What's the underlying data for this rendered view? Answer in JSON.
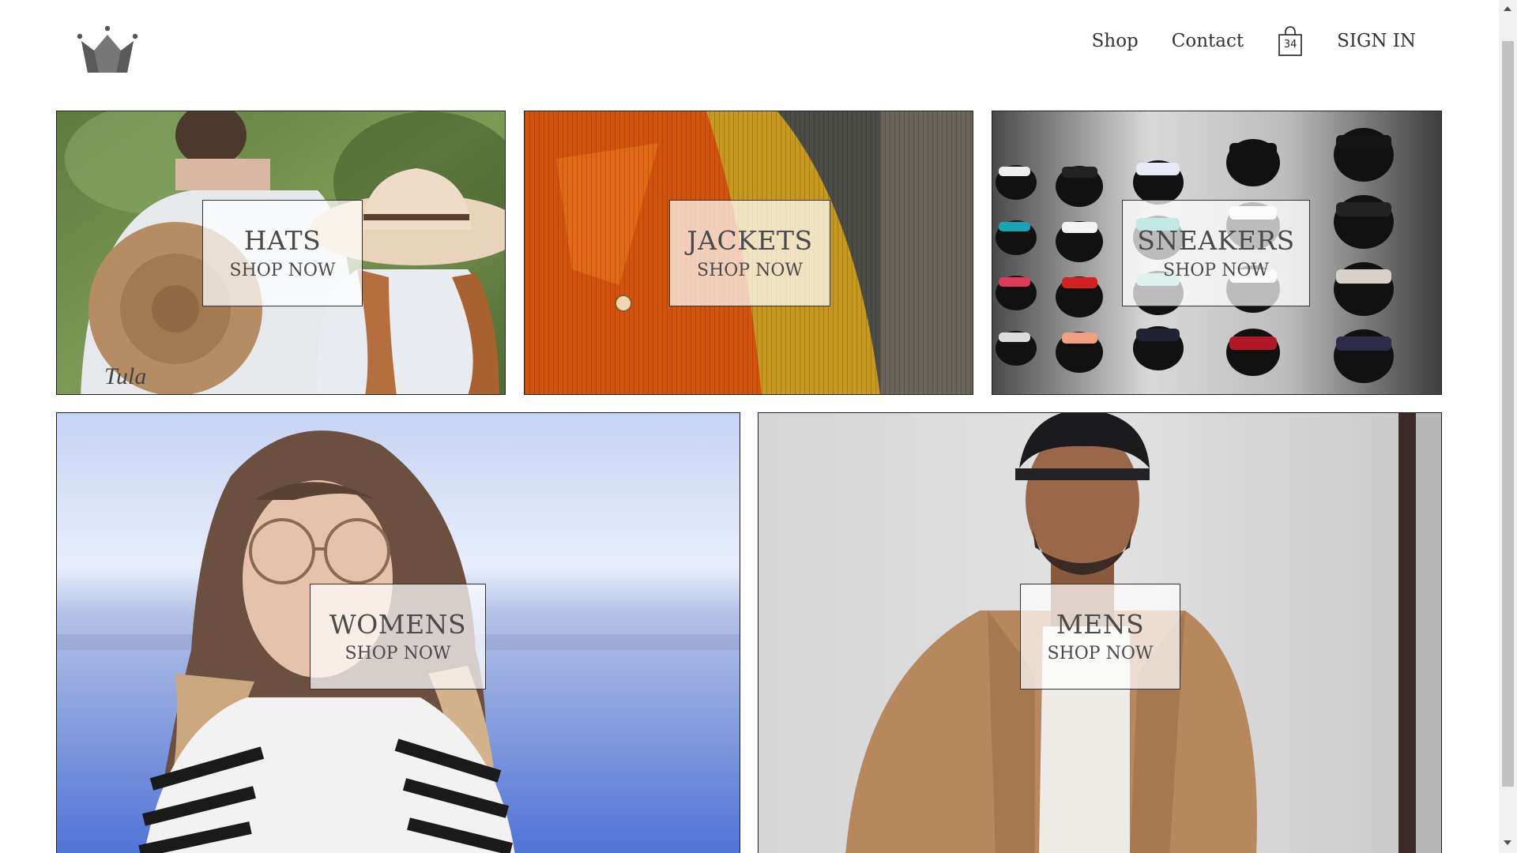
{
  "header": {
    "nav": {
      "shop": "Shop",
      "contact": "Contact",
      "cart_count": "34",
      "sign_in": "SIGN IN"
    }
  },
  "tiles": [
    {
      "title": "HATS",
      "cta": "SHOP NOW"
    },
    {
      "title": "JACKETS",
      "cta": "SHOP NOW"
    },
    {
      "title": "SNEAKERS",
      "cta": "SHOP NOW"
    },
    {
      "title": "WOMENS",
      "cta": "SHOP NOW"
    },
    {
      "title": "MENS",
      "cta": "SHOP NOW"
    }
  ],
  "icons": {
    "logo": "crown-icon",
    "cart": "shopping-bag-icon"
  }
}
